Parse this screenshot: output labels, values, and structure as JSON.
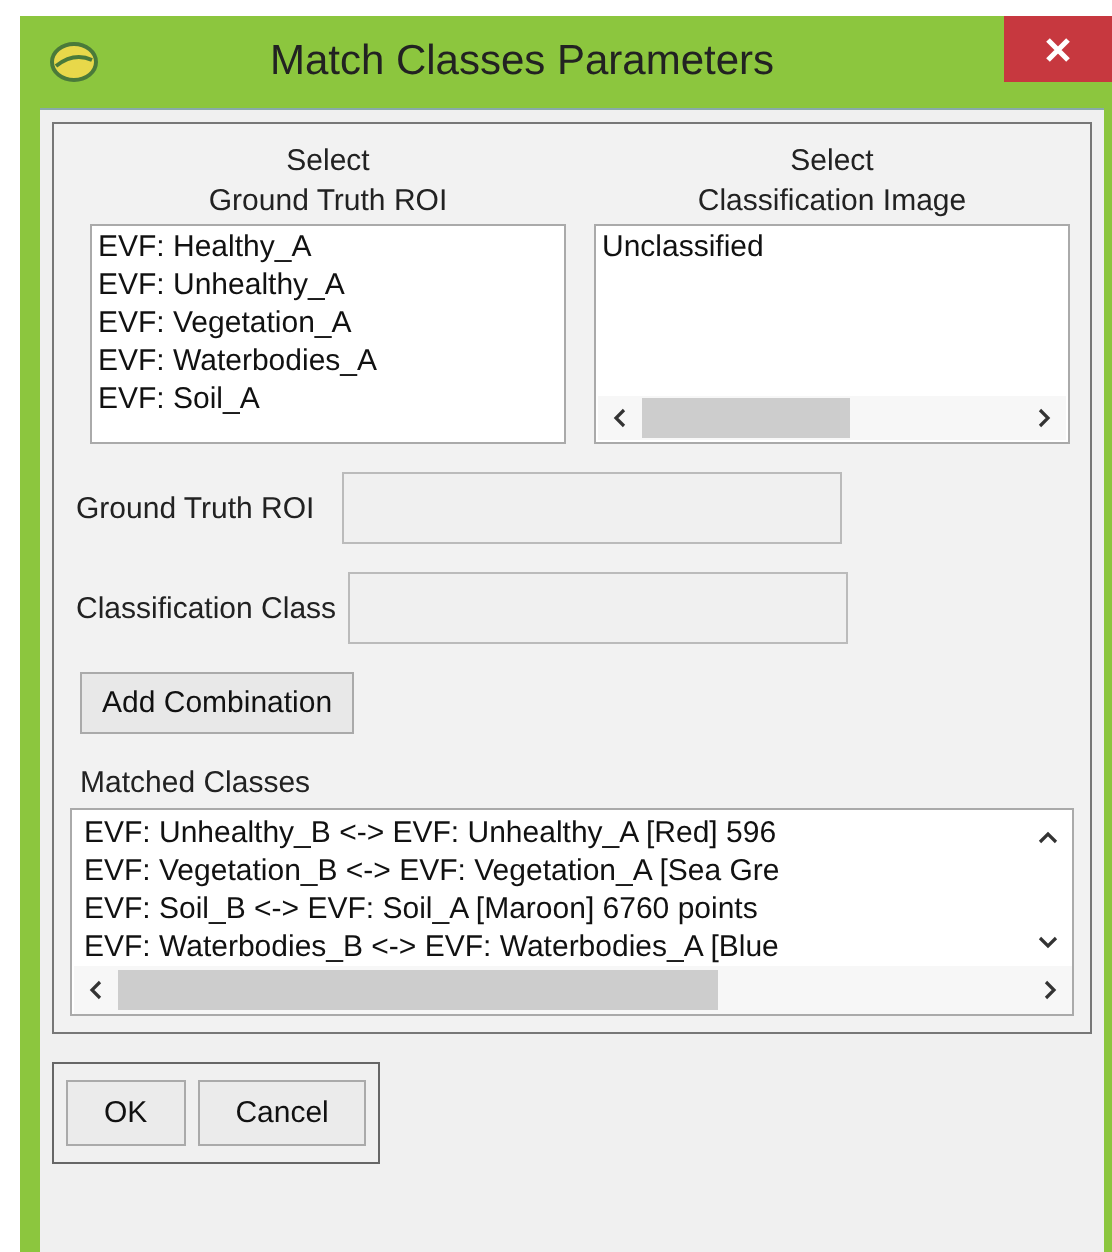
{
  "window": {
    "title": "Match Classes Parameters"
  },
  "ground_truth_list": {
    "heading_lines": [
      "Select",
      "Ground Truth ROI"
    ],
    "items": [
      {
        "label": "EVF: Healthy_A",
        "selected": false
      },
      {
        "label": "EVF: Unhealthy_A",
        "selected": false
      },
      {
        "label": "EVF: Vegetation_A",
        "selected": false
      },
      {
        "label": "EVF: Waterbodies_A",
        "selected": false
      },
      {
        "label": "EVF: Soil_A",
        "selected": false
      }
    ]
  },
  "classification_list": {
    "heading_lines": [
      "Select",
      "Classification Image"
    ],
    "items": [
      {
        "label": "Unclassified",
        "selected": false
      }
    ]
  },
  "fields": [
    {
      "label": "Ground Truth ROI"
    },
    {
      "label": "Classification Class"
    }
  ],
  "add_button": "Add Combination",
  "matched": {
    "label": "Matched Classes",
    "items": [
      "EVF: Unhealthy_B <-> EVF: Unhealthy_A [Red] 596",
      "EVF: Vegetation_B <-> EVF: Vegetation_A [Sea Gre",
      "EVF: Soil_B <-> EVF: Soil_A [Maroon] 6760 points",
      "EVF: Waterbodies_B <-> EVF: Waterbodies_A [Blue"
    ]
  },
  "buttons": [
    "OK",
    "Cancel"
  ]
}
